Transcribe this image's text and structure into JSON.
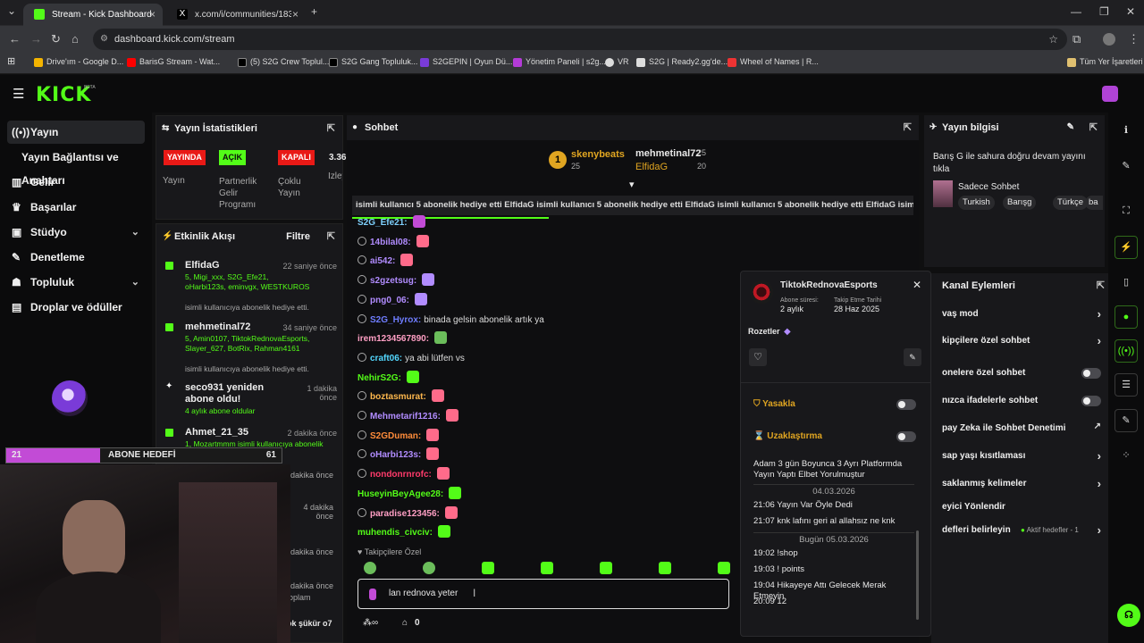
{
  "browser": {
    "tabs": [
      {
        "label": "Stream - Kick Dashboard"
      },
      {
        "label": "x.com/i/communities/18353193..."
      }
    ],
    "url": "dashboard.kick.com/stream",
    "bookmarks": [
      "Drive'ım - Google D...",
      "BarisG Stream - Wat...",
      "(5) S2G Crew Toplul...",
      "S2G Gang Topluluk...",
      "S2GEPIN | Oyun Dü...",
      "Yönetim Paneli | s2g...",
      "VR",
      "S2G | Ready2.gg'de...",
      "Wheel of Names | R..."
    ],
    "all_bookmarks": "Tüm Yer İşaretleri"
  },
  "brand": {
    "logo": "KICK",
    "beta": "BETA",
    "accent": "#53fc18"
  },
  "sidebar": {
    "items": [
      {
        "label": "Yayın",
        "icon": "broadcast-icon"
      },
      {
        "label": "Yayın Bağlantısı ve Anahtarı",
        "icon": ""
      },
      {
        "label": "Gelir",
        "icon": "chart-icon"
      },
      {
        "label": "Başarılar",
        "icon": "trophy-icon"
      },
      {
        "label": "Stüdyo",
        "icon": "studio-icon"
      },
      {
        "label": "Denetleme",
        "icon": "wrench-icon"
      },
      {
        "label": "Topluluk",
        "icon": "people-icon"
      },
      {
        "label": "Droplar ve ödüller",
        "icon": "gift-icon"
      }
    ]
  },
  "stats": {
    "title": "Yayın İstatistikleri",
    "badges": [
      {
        "label": "YAYINDA",
        "color": "#e91916"
      },
      {
        "label": "AÇIK",
        "color": "#53fc18"
      },
      {
        "label": "KAPALI",
        "color": "#e91916"
      },
      {
        "label": "3.36"
      }
    ],
    "labels": [
      "Yayın",
      "Partnerlik Gelir Programı",
      "Çoklu Yayın",
      "İzley"
    ]
  },
  "activity": {
    "title": "Etkinlik Akışı",
    "filter": "Filtre",
    "items": [
      {
        "name": "ElfidaG",
        "time": "22 saniye önce",
        "gift": "5, Migi_xxx, S2G_Efe21, oHarbi123s, eminvgx, WESTKUROS",
        "desc": "isimli kullanıcıya abonelik hediye etti."
      },
      {
        "name": "mehmetinal72",
        "time": "34 saniye önce",
        "gift": "5, Amin0107, TiktokRednovaEsports, Slayer_627, BotRix, Rahman4161",
        "desc": "isimli kullanıcıya abonelik hediye etti."
      },
      {
        "name": "seco931 yeniden abone oldu!",
        "time": "1 dakika önce",
        "gift": "4 aylık abone oldular",
        "desc": ""
      },
      {
        "name": "Ahmet_21_35",
        "time": "2 dakika önce",
        "gift": "1, Mozartmmm isimli kullanıcıya abonelik hediye etti.",
        "desc": ""
      }
    ],
    "extra_times": [
      "2 dakika önce",
      "4 dakika önce",
      "2 dakika önce",
      "2 dakika önce"
    ],
    "extra_text": [
      "oplam",
      "ok şükür o7"
    ]
  },
  "overlay": {
    "goal_current": "21",
    "goal_label": "ABONE HEDEFİ",
    "goal_target": "61",
    "goal_progress": 0.34
  },
  "chat": {
    "title": "Sohbet",
    "top_gifters": [
      {
        "name": "skenybeats",
        "count": "25",
        "rank": "1"
      },
      {
        "name": "mehmetinal72",
        "count": "25"
      },
      {
        "name": "ElfidaG",
        "count": "20"
      }
    ],
    "ticker": "isimli kullanıcı 5 abonelik hediye etti  ElfidaG isimli kullanıcı 5 abonelik hediye etti  ElfidaG isimli kullanıcı 5 abonelik hediye etti  ElfidaG isimli kullanıcı 5 abonelik hediye etti",
    "messages": [
      {
        "user": "S2G_Efe21:",
        "color": "#7fd2ff",
        "text": ""
      },
      {
        "user": "14bilal08:",
        "color": "#b18cff",
        "text": ""
      },
      {
        "user": "ai542:",
        "color": "#b18cff",
        "text": ""
      },
      {
        "user": "s2gzetsug:",
        "color": "#b18cff",
        "text": ""
      },
      {
        "user": "png0_06:",
        "color": "#b18cff",
        "text": ""
      },
      {
        "user": "S2G_Hyrox:",
        "color": "#6f7dff",
        "text": "binada gelsin abonelik artık ya"
      },
      {
        "user": "irem1234567890:",
        "color": "#ff9fc4",
        "text": ""
      },
      {
        "user": "craft06:",
        "color": "#53d8ff",
        "text": "ya abi lütfen vs"
      },
      {
        "user": "NehirS2G:",
        "color": "#53fc18",
        "text": ""
      },
      {
        "user": "boztasmurat:",
        "color": "#ffb84d",
        "text": ""
      },
      {
        "user": "Mehmetarif1216:",
        "color": "#b18cff",
        "text": ""
      },
      {
        "user": "S2GDuman:",
        "color": "#ff8c3a",
        "text": ""
      },
      {
        "user": "oHarbi123s:",
        "color": "#b18cff",
        "text": ""
      },
      {
        "user": "nondonrnrofc:",
        "color": "#ff3b6b",
        "text": ""
      },
      {
        "user": "HuseyinBeyAgee28:",
        "color": "#53fc18",
        "text": ""
      },
      {
        "user": "paradise123456:",
        "color": "#ff9fc4",
        "text": ""
      },
      {
        "user": "muhendis_civciv:",
        "color": "#53fc18",
        "text": ""
      }
    ],
    "followers_only": "Takipçilere Özel",
    "input_value": "lan rednova yeter",
    "bottom_count": "0"
  },
  "user_card": {
    "name": "TiktokRednovaEsports",
    "sub_label": "Abone süresi:",
    "sub_value": "2 aylık",
    "follow_label": "Takip Etme Tarihi",
    "follow_value": "28 Haz 2025",
    "badges_label": "Rozetler",
    "ban": "Yasakla",
    "timeout": "Uzaklaştırma",
    "history": [
      {
        "t": "",
        "m": "Adam 3 gün Boyunca 3 Ayrı Platformda Yayın Yaptı Elbet Yorulmuştur"
      },
      {
        "t": "sep",
        "m": "04.03.2026"
      },
      {
        "t": "21:06",
        "m": "Yayın Var Öyle Dedi"
      },
      {
        "t": "21:07",
        "m": "knk lafını geri al allahsız ne knk"
      },
      {
        "t": "sep",
        "m": "Bugün 05.03.2026"
      },
      {
        "t": "19:02",
        "m": "!shop"
      },
      {
        "t": "19:03",
        "m": "! points"
      },
      {
        "t": "19:04",
        "m": "Hikayeye Attı Gelecek Merak Etmeyin"
      },
      {
        "t": "20:09",
        "m": "12"
      }
    ]
  },
  "stream_info": {
    "title": "Yayın bilgisi",
    "stream_title": "Barış G ile sahura doğru devam yayını tıkla",
    "category": "Sadece Sohbet",
    "tags": [
      "Turkish",
      "Barışg",
      "Türkçe",
      "ba"
    ]
  },
  "channel_actions": {
    "title": "Kanal Eylemleri",
    "items": [
      "vaş mod",
      "kipçilere özel sohbet",
      "onelere özel sohbet",
      "nızca ifadelerle sohbet",
      "pay Zeka ile Sohbet Denetimi",
      "sap yaşı kısıtlaması",
      "saklanmış kelimeler",
      "eyici Yönlendir",
      "defleri belirleyin"
    ],
    "goal_status": "Aktif hedefler - 1"
  }
}
